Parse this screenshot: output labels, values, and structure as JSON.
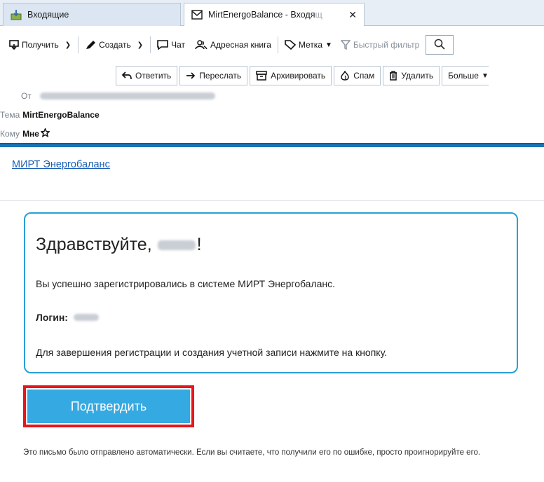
{
  "tabs": [
    {
      "label": "Входящие",
      "icon": "inbox-icon"
    },
    {
      "label_main": "MirtEnergoBalance - Входя",
      "label_fade": "щ",
      "icon": "envelope-icon"
    }
  ],
  "toolbar": {
    "get_label": "Получить",
    "compose_label": "Создать",
    "chat_label": "Чат",
    "addressbook_label": "Адресная книга",
    "tag_label": "Метка",
    "quickfilter_label": "Быстрый фильтр"
  },
  "actions": {
    "reply": "Ответить",
    "forward": "Переслать",
    "archive": "Архивировать",
    "spam": "Спам",
    "delete": "Удалить",
    "more": "Больше"
  },
  "header": {
    "from_label": "От",
    "subject_label": "Тема",
    "subject_value": "MirtEnergoBalance",
    "to_label": "Кому",
    "to_value": "Мне"
  },
  "message": {
    "sender_link": "МИРТ Энергобаланс",
    "greeting": "Здравствуйте,",
    "greeting_end": "!",
    "line1": "Вы успешно зарегистрировались в системе МИРТ Энергобаланс.",
    "login_label": "Логин:",
    "line3": "Для завершения регистрации и создания учетной записи нажмите на кнопку.",
    "confirm_button": "Подтвердить",
    "footer": "Это письмо было отправлено автоматически. Если вы считаете, что получили его по ошибке, просто проигнорируйте его."
  },
  "colors": {
    "accent": "#1875b8",
    "card_border": "#2a9fd6",
    "button_bg": "#35a9e1",
    "highlight": "#e8151b",
    "link": "#1a5fb4"
  }
}
